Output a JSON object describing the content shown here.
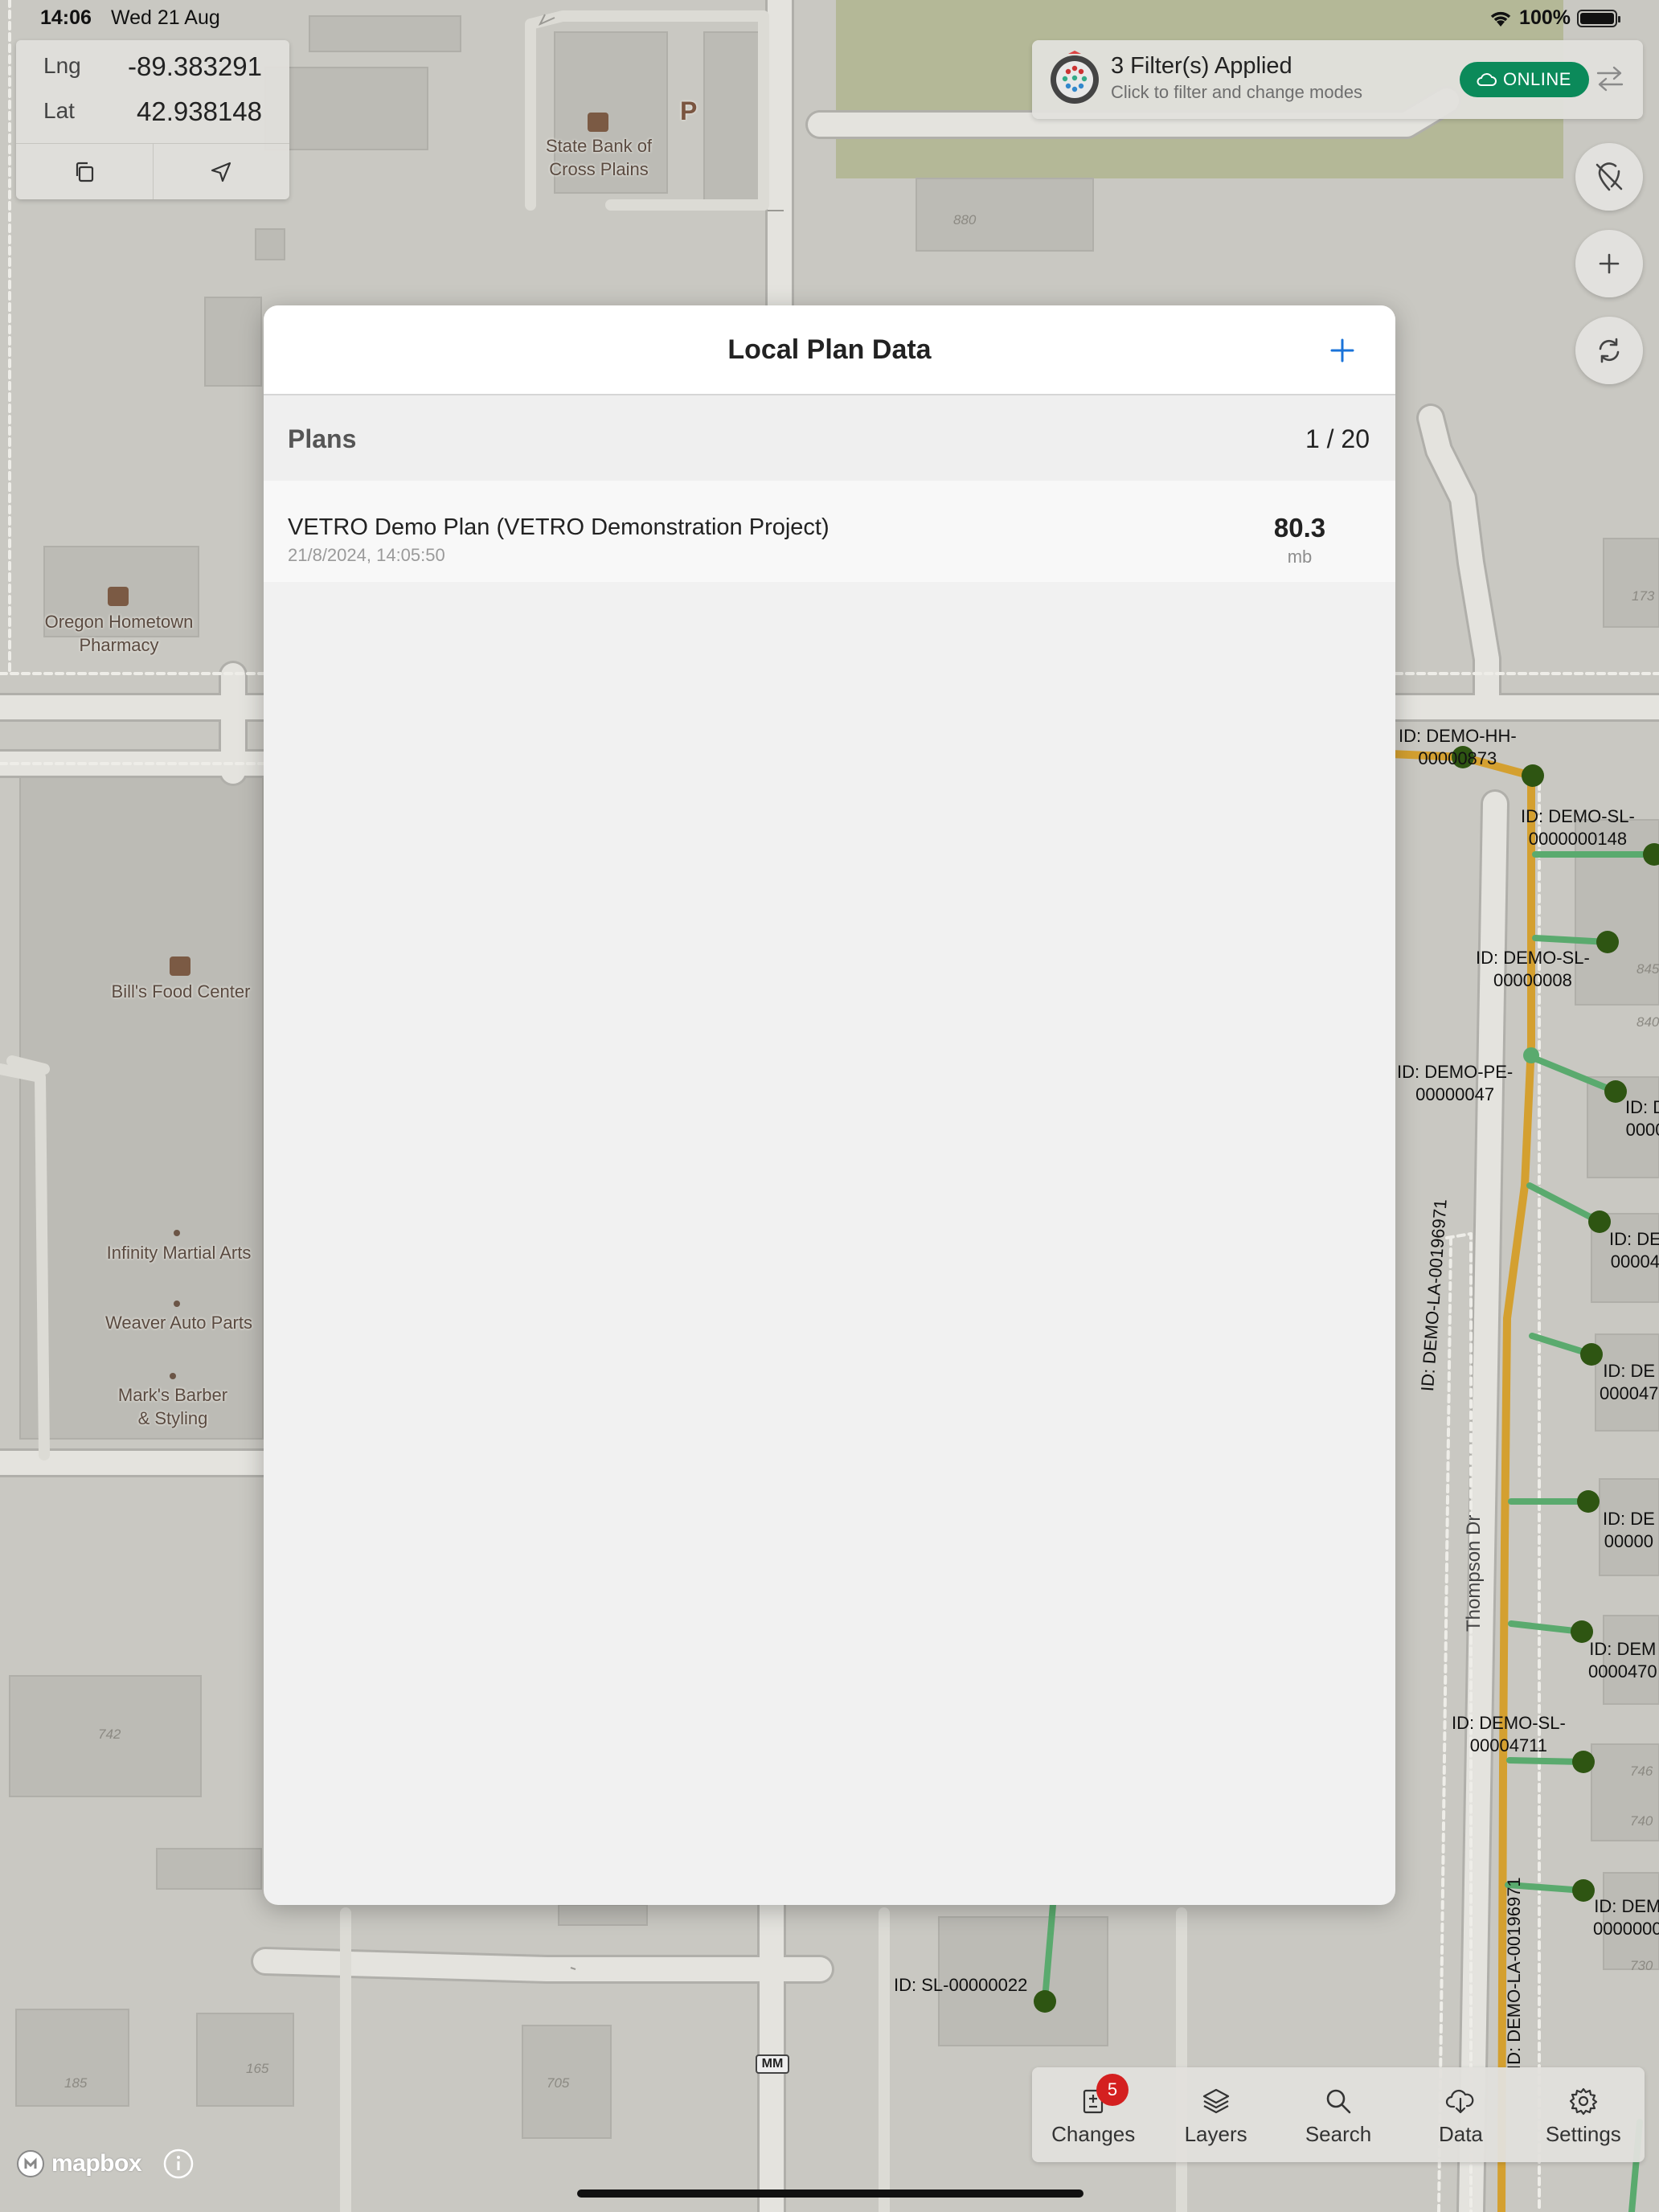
{
  "status_bar": {
    "time": "14:06",
    "date": "Wed 21 Aug",
    "battery": "100%"
  },
  "coords": {
    "lng_label": "Lng",
    "lng_value": "-89.383291",
    "lat_label": "Lat",
    "lat_value": "42.938148"
  },
  "filter_bar": {
    "title": "3 Filter(s) Applied",
    "subtitle": "Click to filter and change modes",
    "status": "ONLINE"
  },
  "modal": {
    "title": "Local Plan Data",
    "section_title": "Plans",
    "section_count": "1 / 20",
    "plans": [
      {
        "name": "VETRO Demo Plan (VETRO Demonstration Project)",
        "date": "21/8/2024, 14:05:50",
        "size": "80.3",
        "unit": "mb"
      }
    ]
  },
  "map": {
    "pois": {
      "bank": "State Bank of\nCross Plains",
      "parking": "P",
      "pharmacy": "Oregon Hometown\nPharmacy",
      "food": "Bill's Food Center",
      "martial": "Infinity Martial Arts",
      "auto": "Weaver Auto Parts",
      "barber": "Mark's Barber\n& Styling"
    },
    "road": "Thompson Dr",
    "house_numbers": [
      "880",
      "173",
      "845",
      "840",
      "742",
      "746",
      "740",
      "730",
      "185",
      "165",
      "705"
    ],
    "features": [
      "ID: DEMO-HH-\n00000873",
      "ID: DEMO-SL-\n0000000148",
      "ID: DEMO-SL-\n00000008",
      "ID: DEMO-PE-\n00000047",
      "ID: D\n0000",
      "ID: DE\n00004",
      "ID: DE\n000047",
      "ID: DE\n00000",
      "ID: DEM\n0000470",
      "ID: DEMO-SL-\n00004711",
      "ID: DEM\n0000000",
      "ID: SL-00000022",
      "ID: DEMO-LA-00196971",
      "ID: DEMO-LA-00196971"
    ],
    "shield": "MM",
    "attribution": "mapbox"
  },
  "tabs": [
    {
      "label": "Changes",
      "icon": "changes-icon",
      "badge": "5"
    },
    {
      "label": "Layers",
      "icon": "layers-icon"
    },
    {
      "label": "Search",
      "icon": "search-icon"
    },
    {
      "label": "Data",
      "icon": "cloud-download-icon"
    },
    {
      "label": "Settings",
      "icon": "gear-icon"
    }
  ],
  "colors": {
    "online": "#0b8a5a",
    "accent_blue": "#1a73d9",
    "badge_red": "#d42020",
    "fiber_orange": "#d4a030",
    "drop_green": "#5aaa6e",
    "node_dark": "#2e5512"
  }
}
